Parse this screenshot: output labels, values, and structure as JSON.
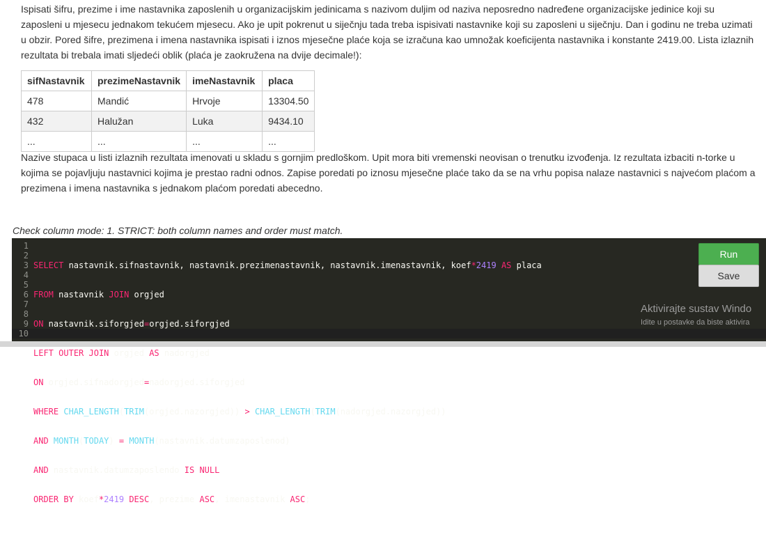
{
  "task": {
    "paragraph1": "Ispisati šifru, prezime i ime nastavnika zaposlenih u organizacijskim jedinicama s nazivom duljim od naziva neposredno nadređene organizacijske jedinice koji su zaposleni u mjesecu jednakom tekućem mjesecu. Ako je upit pokrenut u siječnju tada treba ispisivati nastavnike koji su zaposleni u siječnju. Dan i godinu ne treba uzimati u obzir. Pored šifre, prezimena i imena nastavnika ispisati i iznos mjesečne plaće koja se izračuna kao umnožak koeficijenta nastavnika i konstante 2419.00. Lista izlaznih rezultata bi trebala imati sljedeći oblik (plaća je zaokružena na dvije decimale!):",
    "paragraph2": "Nazive stupaca u listi izlaznih rezultata imenovati u skladu s gornjim predloškom. Upit mora biti vremenski neovisan o trenutku izvođenja. Iz rezultata izbaciti n-torke u kojima se pojavljuju nastavnici kojima je prestao radni odnos. Zapise poredati po iznosu mjesečne plaće tako da se na vrhu popisa nalaze nastavnici s najvećom plaćom a prezimena i imena nastavnika s jednakom plaćom poredati abecedno."
  },
  "sample_table": {
    "headers": [
      "sifNastavnik",
      "prezimeNastavnik",
      "imeNastavnik",
      "placa"
    ],
    "rows": [
      [
        "478",
        "Mandić",
        "Hrvoje",
        "13304.50"
      ],
      [
        "432",
        "Halužan",
        "Luka",
        "9434.10"
      ],
      [
        "...",
        "...",
        "...",
        "..."
      ]
    ]
  },
  "check_mode": "Check column mode: 1. STRICT: both column names and order must match.",
  "editor": {
    "line_numbers": [
      "1",
      "2",
      "3",
      "4",
      "5",
      "6",
      "7",
      "8",
      "9",
      "10"
    ],
    "lines": [
      "SELECT nastavnik.sifnastavnik, nastavnik.prezimenastavnik, nastavnik.imenastavnik, koef*2419 AS placa",
      "FROM nastavnik JOIN orgjed",
      "ON nastavnik.siforgjed=orgjed.siforgjed",
      "LEFT OUTER JOIN orgjed AS nadorgjed",
      "ON orgjed.sifnadorgjed=nadorgjed.siforgjed",
      "WHERE CHAR_LENGTH(TRIM(orgjed.nazorgjed)) > CHAR_LENGTH(TRIM(nadorgjed.nazorgjed))",
      "AND MONTH(TODAY) = MONTH(nastavnik.datumzaposlenod)",
      "AND nastavnik.datumzaposlendo IS NULL",
      "ORDER BY koef*2419 DESC, prezime ASC, imenastavnik ASC;",
      ""
    ]
  },
  "buttons": {
    "run": "Run",
    "save": "Save"
  },
  "watermark": {
    "title": "Aktivirajte sustav Windo",
    "subtitle": "Idite u postavke da biste aktivira"
  },
  "colors": {
    "editor_bg": "#272822",
    "keyword": "#f92672",
    "function": "#66d9ef",
    "number": "#ae81ff",
    "run_button": "#4caf50"
  }
}
